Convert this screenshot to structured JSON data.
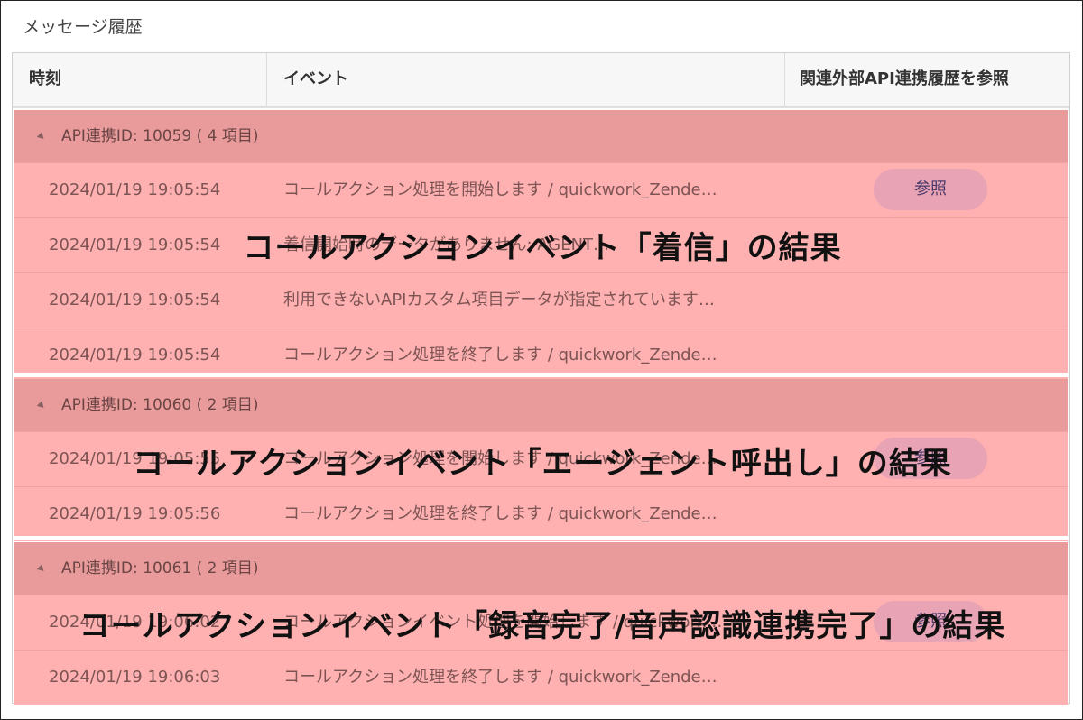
{
  "panel": {
    "title": "メッセージ履歴"
  },
  "table": {
    "headers": {
      "time": "時刻",
      "event": "イベント",
      "reference": "関連外部API連携履歴を参照"
    }
  },
  "groups": [
    {
      "header": "API連携ID: 10059 ( 4 項目)",
      "rows": [
        {
          "time": "2024/01/19 19:05:54",
          "event": "コールアクション処理を開始します / quickwork_Zende…",
          "reference": "参照"
        },
        {
          "time": "2024/01/19 19:05:54",
          "event": "着信開始時のデータがありません: AGENT…",
          "reference": ""
        },
        {
          "time": "2024/01/19 19:05:54",
          "event": "利用できないAPIカスタム項目データが指定されています…",
          "reference": ""
        },
        {
          "time": "2024/01/19 19:05:54",
          "event": "コールアクション処理を終了します / quickwork_Zende…",
          "reference": ""
        }
      ]
    },
    {
      "header": "API連携ID: 10060 ( 2 項目)",
      "rows": [
        {
          "time": "2024/01/19 19:05:55",
          "event": "コールアクション処理を開始します / quickwork_Zende…",
          "reference": "参照"
        },
        {
          "time": "2024/01/19 19:05:56",
          "event": "コールアクション処理を終了します / quickwork_Zende…",
          "reference": ""
        }
      ]
    },
    {
      "header": "API連携ID: 10061 ( 2 項目)",
      "rows": [
        {
          "time": "2024/01/19 19:06:02",
          "event": "コールアクションイベント処理を開始します / quickwork…",
          "reference": "参照"
        },
        {
          "time": "2024/01/19 19:06:03",
          "event": "コールアクション処理を終了します / quickwork_Zende…",
          "reference": ""
        }
      ]
    }
  ],
  "overlays": [
    "コールアクションイベント「着信」の結果",
    "コールアクションイベント「エージェント呼出し」の結果",
    "コールアクションイベント「録音完了/音声認識連携完了」の結果"
  ]
}
